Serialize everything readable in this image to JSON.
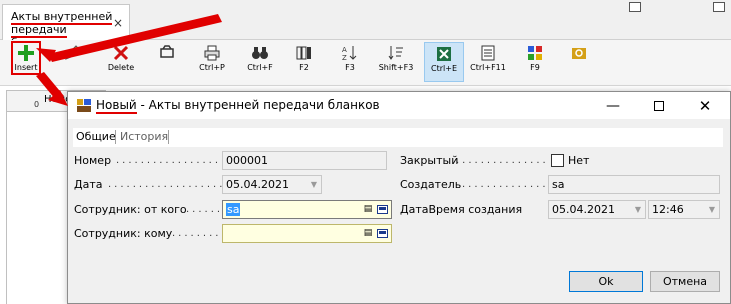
{
  "app": {
    "tab_title": "Акты внутренней передачи бланков",
    "tab_close": "×"
  },
  "toolbar": {
    "buttons": [
      {
        "label": "Insert",
        "icon": "add-plus-icon",
        "color": "#1e9e1e"
      },
      {
        "label": "",
        "icon": "pencil-edit-icon"
      },
      {
        "label": "Delete",
        "icon": "delete-x-icon",
        "color": "#d01010"
      },
      {
        "label": "",
        "icon": "refresh-icon"
      },
      {
        "label": "Ctrl+P",
        "icon": "printer-icon"
      },
      {
        "label": "Ctrl+F",
        "icon": "binoculars-icon"
      },
      {
        "label": "F2",
        "icon": "columns-icon"
      },
      {
        "label": "F3",
        "icon": "sort-az-icon"
      },
      {
        "label": "Shift+F3",
        "icon": "sort-filter-icon"
      },
      {
        "label": "Ctrl+E",
        "icon": "excel-icon",
        "color": "#1d6f42"
      },
      {
        "label": "Ctrl+F11",
        "icon": "document-list-icon"
      },
      {
        "label": "F9",
        "icon": "color-grid-icon"
      },
      {
        "label": "",
        "icon": "folder-search-icon"
      }
    ]
  },
  "grid": {
    "col_number_header": "Номер",
    "col_number_value": "0"
  },
  "dialog": {
    "title_highlight": "Новый",
    "title_rest": " - Акты внутренней передачи бланков",
    "tabs": [
      "Общие",
      "История"
    ],
    "fields": {
      "nomer": {
        "label": "Номер",
        "value": "000001"
      },
      "data": {
        "label": "Дата",
        "value": "05.04.2021"
      },
      "sotr_ot": {
        "label": "Сотрудник: от кого",
        "value": "sa"
      },
      "sotr_komu": {
        "label": "Сотрудник: кому",
        "value": ""
      },
      "zakryty": {
        "label": "Закрытый",
        "value": "Нет"
      },
      "sozdatel": {
        "label": "Создатель",
        "value": "sa"
      },
      "datetime": {
        "label": "ДатаВремя создания",
        "date": "05.04.2021",
        "time": "12:46"
      }
    },
    "buttons": {
      "ok": "Ok",
      "cancel": "Отмена"
    }
  },
  "colors": {
    "annotation_red": "#e00000",
    "accent_blue": "#0078d7",
    "required_field_bg": "#ffffe1"
  }
}
